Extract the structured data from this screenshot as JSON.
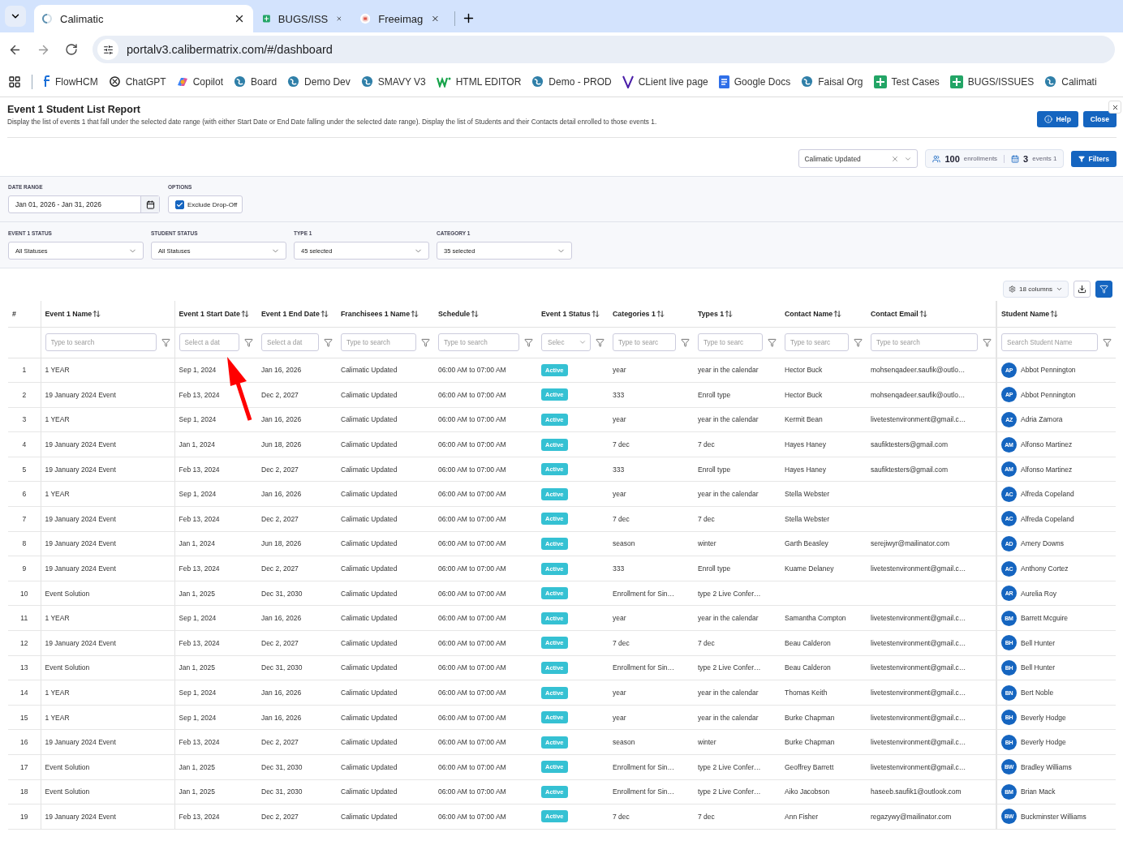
{
  "browser": {
    "tabs": [
      {
        "title": "Calimatic",
        "selected": true
      },
      {
        "title": "BUGS/ISS",
        "selected": false
      },
      {
        "title": "Freeimag",
        "selected": false
      }
    ],
    "address": "portalv3.calibermatrix.com/#/dashboard",
    "bookmarks": [
      {
        "label": "FlowHCM"
      },
      {
        "label": "ChatGPT"
      },
      {
        "label": "Copilot"
      },
      {
        "label": "Board"
      },
      {
        "label": "Demo Dev"
      },
      {
        "label": "SMAVY V3"
      },
      {
        "label": "HTML EDITOR"
      },
      {
        "label": "Demo - PROD"
      },
      {
        "label": "CLient live page"
      },
      {
        "label": "Google Docs"
      },
      {
        "label": "Faisal Org"
      },
      {
        "label": "Test Cases"
      },
      {
        "label": "BUGS/ISSUES"
      },
      {
        "label": "Calimati"
      }
    ]
  },
  "report": {
    "title": "Event 1 Student List Report",
    "description": "Display the list of events 1 that fall under the selected date range (with either Start Date or End Date falling under the selected date range). Display the list of Students and their Contacts detail enrolled to those events 1.",
    "help_button": "Help",
    "close_button": "Close",
    "organization": "Calimatic Updated",
    "enrollments_count": "100",
    "enrollments_label": "enrollments",
    "events_count": "3",
    "events_label": "events 1",
    "filters_button": "Filters"
  },
  "filters": {
    "date_range": {
      "label": "DATE RANGE",
      "value": "Jan 01, 2026 - Jan 31, 2026"
    },
    "options": {
      "label": "OPTIONS",
      "checkbox": {
        "label": "Exclude Drop-Off",
        "checked": true
      }
    },
    "selects": [
      {
        "label": "EVENT 1 STATUS",
        "value": "All Statuses"
      },
      {
        "label": "STUDENT STATUS",
        "value": "All Statuses"
      },
      {
        "label": "TYPE 1",
        "value": "45 selected"
      },
      {
        "label": "CATEGORY 1",
        "value": "35 selected"
      }
    ]
  },
  "table_toolbar": {
    "columns_button": "18 columns"
  },
  "table": {
    "columns": [
      {
        "label": "#",
        "sortable": false
      },
      {
        "label": "Event 1 Name",
        "sortable": true,
        "filter": {
          "kind": "text",
          "placeholder": "Type to search"
        }
      },
      {
        "label": "Event 1 Start Date",
        "sortable": true,
        "filter": {
          "kind": "text",
          "placeholder": "Select a dat"
        }
      },
      {
        "label": "Event 1 End Date",
        "sortable": true,
        "filter": {
          "kind": "text",
          "placeholder": "Select a dat"
        }
      },
      {
        "label": "Franchisees 1 Name",
        "sortable": true,
        "filter": {
          "kind": "text",
          "placeholder": "Type to search"
        }
      },
      {
        "label": "Schedule",
        "sortable": true,
        "filter": {
          "kind": "text",
          "placeholder": "Type to search"
        }
      },
      {
        "label": "Event 1 Status",
        "sortable": true,
        "filter": {
          "kind": "select",
          "placeholder": "Selec"
        }
      },
      {
        "label": "Categories 1",
        "sortable": true,
        "filter": {
          "kind": "text",
          "placeholder": "Type to searc"
        }
      },
      {
        "label": "Types 1",
        "sortable": true,
        "filter": {
          "kind": "text",
          "placeholder": "Type to searc"
        }
      },
      {
        "label": "Contact Name",
        "sortable": true,
        "filter": {
          "kind": "text",
          "placeholder": "Type to searc"
        }
      },
      {
        "label": "Contact Email",
        "sortable": true,
        "filter": {
          "kind": "text",
          "placeholder": "Type to search"
        }
      },
      {
        "label": "Student Name",
        "sortable": true,
        "filter": {
          "kind": "text",
          "placeholder": "Search Student Name"
        }
      }
    ],
    "rows": [
      {
        "n": "1",
        "event": "1 YEAR",
        "start": "Sep 1, 2024",
        "end": "Jan 16, 2026",
        "franchisee": "Calimatic Updated",
        "schedule": "06:00 AM to 07:00 AM",
        "status": "Active",
        "category": "year",
        "type": "year in the calendar",
        "contact": "Hector Buck",
        "email": "mohsenqadeer.saufik@outlo…",
        "initials": "AP",
        "student": "Abbot Pennington"
      },
      {
        "n": "2",
        "event": "19 January 2024 Event",
        "start": "Feb 13, 2024",
        "end": "Dec 2, 2027",
        "franchisee": "Calimatic Updated",
        "schedule": "06:00 AM to 07:00 AM",
        "status": "Active",
        "category": "333",
        "type": "Enroll type",
        "contact": "Hector Buck",
        "email": "mohsenqadeer.saufik@outlo…",
        "initials": "AP",
        "student": "Abbot Pennington"
      },
      {
        "n": "3",
        "event": "1 YEAR",
        "start": "Sep 1, 2024",
        "end": "Jan 16, 2026",
        "franchisee": "Calimatic Updated",
        "schedule": "06:00 AM to 07:00 AM",
        "status": "Active",
        "category": "year",
        "type": "year in the calendar",
        "contact": "Kermit Bean",
        "email": "livetestenvironment@gmail.c…",
        "initials": "AZ",
        "student": "Adria Zamora"
      },
      {
        "n": "4",
        "event": "19 January 2024 Event",
        "start": "Jan 1, 2024",
        "end": "Jun 18, 2026",
        "franchisee": "Calimatic Updated",
        "schedule": "06:00 AM to 07:00 AM",
        "status": "Active",
        "category": "7 dec",
        "type": "7 dec",
        "contact": "Hayes Haney",
        "email": "saufiktesters@gmail.com",
        "initials": "AM",
        "student": "Alfonso Martinez"
      },
      {
        "n": "5",
        "event": "19 January 2024 Event",
        "start": "Feb 13, 2024",
        "end": "Dec 2, 2027",
        "franchisee": "Calimatic Updated",
        "schedule": "06:00 AM to 07:00 AM",
        "status": "Active",
        "category": "333",
        "type": "Enroll type",
        "contact": "Hayes Haney",
        "email": "saufiktesters@gmail.com",
        "initials": "AM",
        "student": "Alfonso Martinez"
      },
      {
        "n": "6",
        "event": "1 YEAR",
        "start": "Sep 1, 2024",
        "end": "Jan 16, 2026",
        "franchisee": "Calimatic Updated",
        "schedule": "06:00 AM to 07:00 AM",
        "status": "Active",
        "category": "year",
        "type": "year in the calendar",
        "contact": "Stella Webster",
        "initials": "AC",
        "student": "Alfreda Copeland"
      },
      {
        "n": "7",
        "event": "19 January 2024 Event",
        "start": "Feb 13, 2024",
        "end": "Dec 2, 2027",
        "franchisee": "Calimatic Updated",
        "schedule": "06:00 AM to 07:00 AM",
        "status": "Active",
        "category": "7 dec",
        "type": "7 dec",
        "contact": "Stella Webster",
        "initials": "AC",
        "student": "Alfreda Copeland"
      },
      {
        "n": "8",
        "event": "19 January 2024 Event",
        "start": "Jan 1, 2024",
        "end": "Jun 18, 2026",
        "franchisee": "Calimatic Updated",
        "schedule": "06:00 AM to 07:00 AM",
        "status": "Active",
        "category": "season",
        "type": "winter",
        "contact": "Garth Beasley",
        "email": "serejiwyr@mailinator.com",
        "initials": "AD",
        "student": "Amery Downs"
      },
      {
        "n": "9",
        "event": "19 January 2024 Event",
        "start": "Feb 13, 2024",
        "end": "Dec 2, 2027",
        "franchisee": "Calimatic Updated",
        "schedule": "06:00 AM to 07:00 AM",
        "status": "Active",
        "category": "333",
        "type": "Enroll type",
        "contact": "Kuame Delaney",
        "email": "livetestenvironment@gmail.c…",
        "initials": "AC",
        "student": "Anthony Cortez"
      },
      {
        "n": "10",
        "event": "Event Solution",
        "start": "Jan 1, 2025",
        "end": "Dec 31, 2030",
        "franchisee": "Calimatic Updated",
        "schedule": "06:00 AM to 07:00 AM",
        "status": "Active",
        "category": "Enrollment for Sin…",
        "type": "type 2 Live Confer…",
        "initials": "AR",
        "student": "Aurelia Roy"
      },
      {
        "n": "11",
        "event": "1 YEAR",
        "start": "Sep 1, 2024",
        "end": "Jan 16, 2026",
        "franchisee": "Calimatic Updated",
        "schedule": "06:00 AM to 07:00 AM",
        "status": "Active",
        "category": "year",
        "type": "year in the calendar",
        "contact": "Samantha Compton",
        "email": "livetestenvironment@gmail.c…",
        "initials": "BM",
        "student": "Barrett Mcguire"
      },
      {
        "n": "12",
        "event": "19 January 2024 Event",
        "start": "Feb 13, 2024",
        "end": "Dec 2, 2027",
        "franchisee": "Calimatic Updated",
        "schedule": "06:00 AM to 07:00 AM",
        "status": "Active",
        "category": "7 dec",
        "type": "7 dec",
        "contact": "Beau Calderon",
        "email": "livetestenvironment@gmail.c…",
        "initials": "BH",
        "student": "Bell Hunter"
      },
      {
        "n": "13",
        "event": "Event Solution",
        "start": "Jan 1, 2025",
        "end": "Dec 31, 2030",
        "franchisee": "Calimatic Updated",
        "schedule": "06:00 AM to 07:00 AM",
        "status": "Active",
        "category": "Enrollment for Sin…",
        "type": "type 2 Live Confer…",
        "contact": "Beau Calderon",
        "email": "livetestenvironment@gmail.c…",
        "initials": "BH",
        "student": "Bell Hunter"
      },
      {
        "n": "14",
        "event": "1 YEAR",
        "start": "Sep 1, 2024",
        "end": "Jan 16, 2026",
        "franchisee": "Calimatic Updated",
        "schedule": "06:00 AM to 07:00 AM",
        "status": "Active",
        "category": "year",
        "type": "year in the calendar",
        "contact": "Thomas Keith",
        "email": "livetestenvironment@gmail.c…",
        "initials": "BN",
        "student": "Bert Noble"
      },
      {
        "n": "15",
        "event": "1 YEAR",
        "start": "Sep 1, 2024",
        "end": "Jan 16, 2026",
        "franchisee": "Calimatic Updated",
        "schedule": "06:00 AM to 07:00 AM",
        "status": "Active",
        "category": "year",
        "type": "year in the calendar",
        "contact": "Burke Chapman",
        "email": "livetestenvironment@gmail.c…",
        "initials": "BH",
        "student": "Beverly Hodge"
      },
      {
        "n": "16",
        "event": "19 January 2024 Event",
        "start": "Feb 13, 2024",
        "end": "Dec 2, 2027",
        "franchisee": "Calimatic Updated",
        "schedule": "06:00 AM to 07:00 AM",
        "status": "Active",
        "category": "season",
        "type": "winter",
        "contact": "Burke Chapman",
        "email": "livetestenvironment@gmail.c…",
        "initials": "BH",
        "student": "Beverly Hodge"
      },
      {
        "n": "17",
        "event": "Event Solution",
        "start": "Jan 1, 2025",
        "end": "Dec 31, 2030",
        "franchisee": "Calimatic Updated",
        "schedule": "06:00 AM to 07:00 AM",
        "status": "Active",
        "category": "Enrollment for Sin…",
        "type": "type 2 Live Confer…",
        "contact": "Geoffrey Barrett",
        "email": "livetestenvironment@gmail.c…",
        "initials": "BW",
        "student": "Bradley Williams"
      },
      {
        "n": "18",
        "event": "Event Solution",
        "start": "Jan 1, 2025",
        "end": "Dec 31, 2030",
        "franchisee": "Calimatic Updated",
        "schedule": "06:00 AM to 07:00 AM",
        "status": "Active",
        "category": "Enrollment for Sin…",
        "type": "type 2 Live Confer…",
        "contact": "Aiko Jacobson",
        "email": "haseeb.saufik1@outlook.com",
        "initials": "BM",
        "student": "Brian Mack"
      },
      {
        "n": "19",
        "event": "19 January 2024 Event",
        "start": "Feb 13, 2024",
        "end": "Dec 2, 2027",
        "franchisee": "Calimatic Updated",
        "schedule": "06:00 AM to 07:00 AM",
        "status": "Active",
        "category": "7 dec",
        "type": "7 dec",
        "contact": "Ann Fisher",
        "email": "regazywy@mailinator.com",
        "initials": "BW",
        "student": "Buckminster Williams"
      }
    ]
  }
}
